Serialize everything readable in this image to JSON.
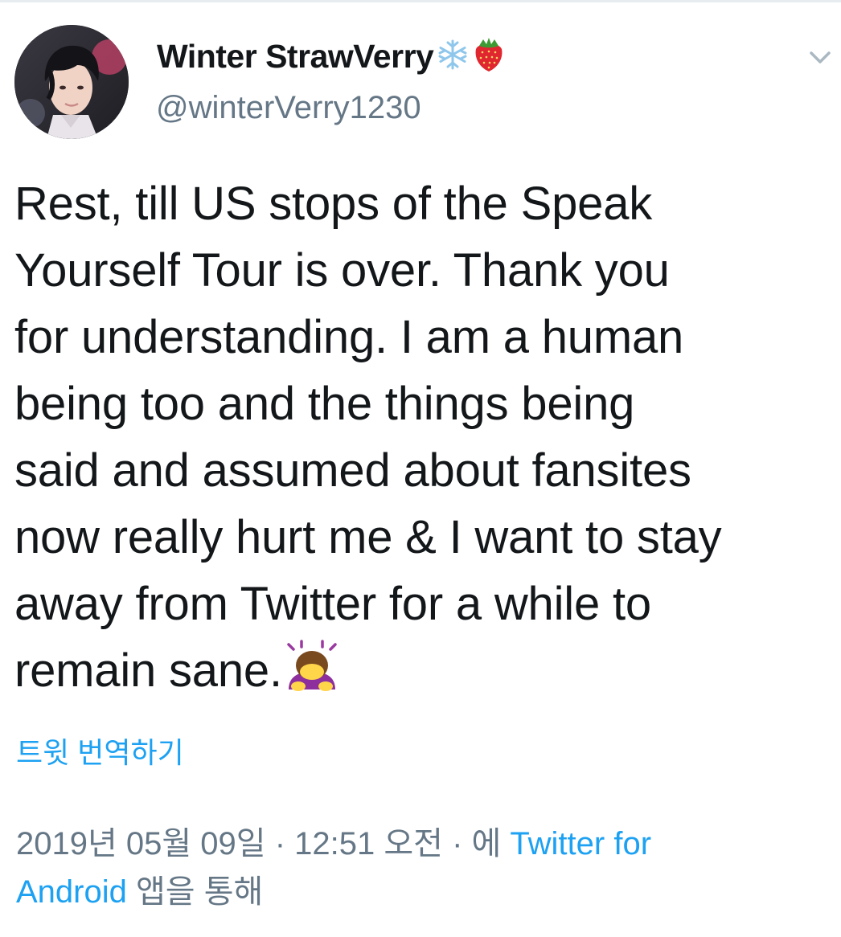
{
  "author": {
    "display_name": "Winter StrawVerry",
    "name_emojis": [
      "snowflake-icon",
      "strawberry-icon"
    ],
    "handle": "@winterVerry1230"
  },
  "tweet": {
    "lines": [
      "Rest, till US stops of the Speak",
      "Yourself Tour is over. Thank you",
      "for understanding. I am a human",
      "being too and the things being",
      "said and assumed about fansites",
      "now really hurt me & I want to stay",
      "away from Twitter for a while to",
      "remain sane."
    ],
    "trailing_emoji": "person-bowing-icon"
  },
  "translate_label": "트윗 번역하기",
  "meta": {
    "timestamp": "2019년 05월 09일 · 12:51 오전 · 에 ",
    "source_part1": "Twitter for",
    "source_part2": "Android",
    "suffix": " 앱을 통해"
  },
  "colors": {
    "accent": "#1da1f2",
    "text": "#14171a",
    "secondary": "#657786"
  }
}
